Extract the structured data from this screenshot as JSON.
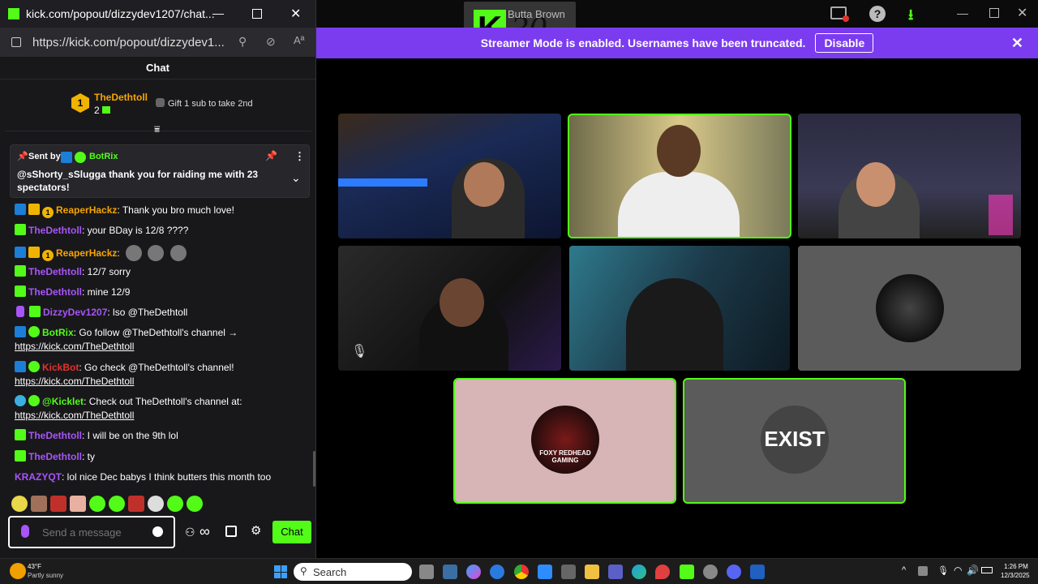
{
  "popout": {
    "title": "kick.com/popout/dizzydev1207/chat...",
    "url": "https://kick.com/popout/dizzydev1...",
    "chat_header": "Chat"
  },
  "gifter": {
    "name": "TheDethtoll",
    "count": "2",
    "gift_text": "Gift 1 sub to take 2nd"
  },
  "pinned": {
    "sent_by": "Sent by",
    "sender": "BotRix",
    "message": "@sShorty_sSlugga thank you for raiding me with 23 spectators!"
  },
  "messages": [
    {
      "user": "ReaperHackz",
      "text": ": Thank you bro much love!",
      "color": "#f7a400"
    },
    {
      "user": "TheDethtoll",
      "text": ": your BDay is 12/8 ????",
      "color": "#a855f7"
    },
    {
      "user": "ReaperHackz",
      "text": ":",
      "color": "#f7a400"
    },
    {
      "user": "TheDethtoll",
      "text": ": 12/7 sorry",
      "color": "#a855f7"
    },
    {
      "user": "TheDethtoll",
      "text": ": mine 12/9",
      "color": "#a855f7"
    },
    {
      "user": "DizzyDev1207",
      "text": ": lso @TheDethtoll",
      "color": "#a855f7"
    },
    {
      "user": "BotRix",
      "text": ": Go follow @TheDethtoll's channel →",
      "link": "https://kick.com/TheDethtoll",
      "color": "#53fc18"
    },
    {
      "user": "KickBot",
      "text": ": Go check @TheDethtoll's channel!",
      "link": "https://kick.com/TheDethtoll",
      "color": "#e5322d"
    },
    {
      "user": "@Kicklet",
      "text": ": Check out TheDethtoll's channel at:",
      "link": "https://kick.com/TheDethtoll",
      "color": "#53fc18"
    },
    {
      "user": "TheDethtoll",
      "text": ": I will be on the 9th lol",
      "color": "#a855f7"
    },
    {
      "user": "TheDethtoll",
      "text": ": ty",
      "color": "#a855f7"
    },
    {
      "user": "KRAZYQT",
      "text": ": lol nice Dec babys I think butters this month too",
      "color": "#a855f7"
    }
  ],
  "input": {
    "placeholder": "Send a message",
    "send_label": "Chat"
  },
  "streamer_bar": {
    "text": "Streamer Mode is enabled. Usernames have been truncated.",
    "disable_label": "Disable"
  },
  "bg_title": "Butta Brown",
  "bg_logo_text": "30",
  "tiles": [
    {
      "label": "streamer-tile-1",
      "color": "#1e2a44"
    },
    {
      "label": "streamer-tile-2",
      "color": "#8a7a4a"
    },
    {
      "label": "streamer-tile-3",
      "color": "#2a2a3a"
    },
    {
      "label": "streamer-tile-4",
      "color": "#1a1a1a"
    },
    {
      "label": "streamer-tile-5",
      "color": "#3b6e8a"
    },
    {
      "label": "streamer-tile-6",
      "color": "#5b5b5b"
    },
    {
      "label": "streamer-tile-7",
      "color": "#d7b4b6"
    },
    {
      "label": "streamer-tile-8",
      "color": "#5b5b5b"
    }
  ],
  "tile_logos": {
    "foxy": "FOXY REDHEAD GAMING",
    "exist": "EXIST"
  },
  "taskbar": {
    "weather_temp": "43°F",
    "weather_desc": "Partly sunny",
    "search_label": "Search",
    "time": "1:26 PM",
    "date": "12/3/2025"
  },
  "colors": {
    "kick_green": "#53fc18",
    "purple_banner": "#7b3cf0"
  }
}
